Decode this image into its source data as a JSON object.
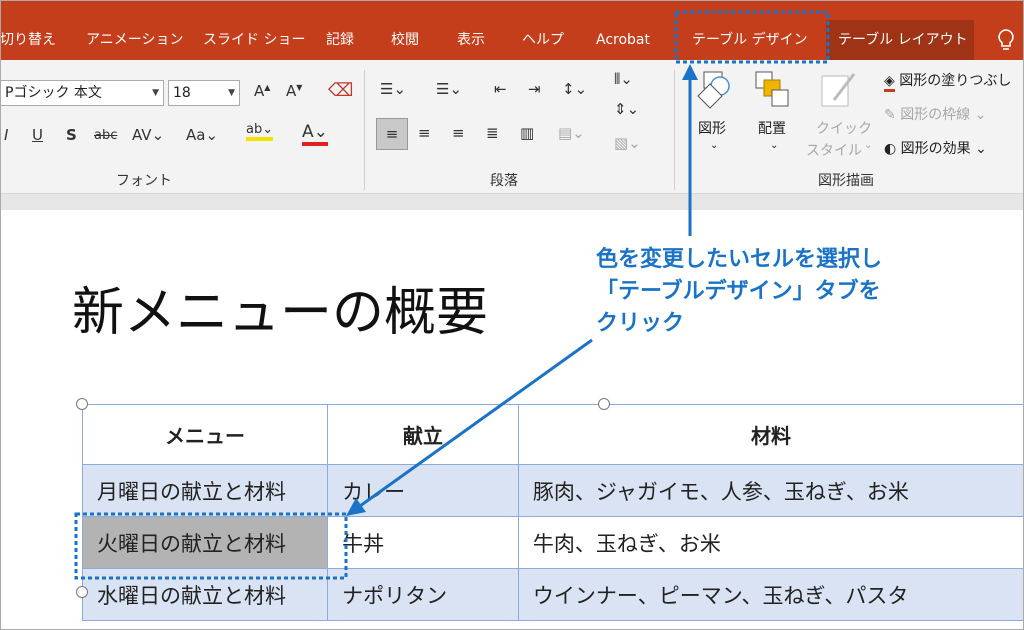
{
  "ribbon_tabs": [
    "切り替え",
    "アニメーション",
    "スライド ショー",
    "記録",
    "校閲",
    "表示",
    "ヘルプ",
    "Acrobat",
    "テーブル デザイン",
    "テーブル レイアウト"
  ],
  "font": {
    "name": "Pゴシック 本文",
    "size": "18",
    "group_label": "フォント"
  },
  "paragraph": {
    "group_label": "段落"
  },
  "drawing": {
    "group_label": "図形描画",
    "shape_label": "図形",
    "arrange_label": "配置",
    "quick_style_line1": "クイック",
    "quick_style_line2": "スタイル",
    "fill_label": "図形の塗りつぶし",
    "outline_label": "図形の枠線",
    "effects_label": "図形の効果"
  },
  "slide": {
    "title": "新メニューの概要",
    "table": {
      "headers": [
        "メニュー",
        "献立",
        "材料"
      ],
      "rows": [
        [
          "月曜日の献立と材料",
          "カレー",
          "豚肉、ジャガイモ、人参、玉ねぎ、お米"
        ],
        [
          "火曜日の献立と材料",
          "牛丼",
          "牛肉、玉ねぎ、お米"
        ],
        [
          "水曜日の献立と材料",
          "ナポリタン",
          "ウインナー、ピーマン、玉ねぎ、パスタ"
        ]
      ]
    }
  },
  "annotation": {
    "text": "色を変更したいセルを選択し\n「テーブルデザイン」タブを\nクリック",
    "color": "#1a73c6"
  },
  "colors": {
    "ribbon_tab_bar": "#c43e1c",
    "table_band": "#dae3f3",
    "selected_cell": "#b3b3b3"
  }
}
